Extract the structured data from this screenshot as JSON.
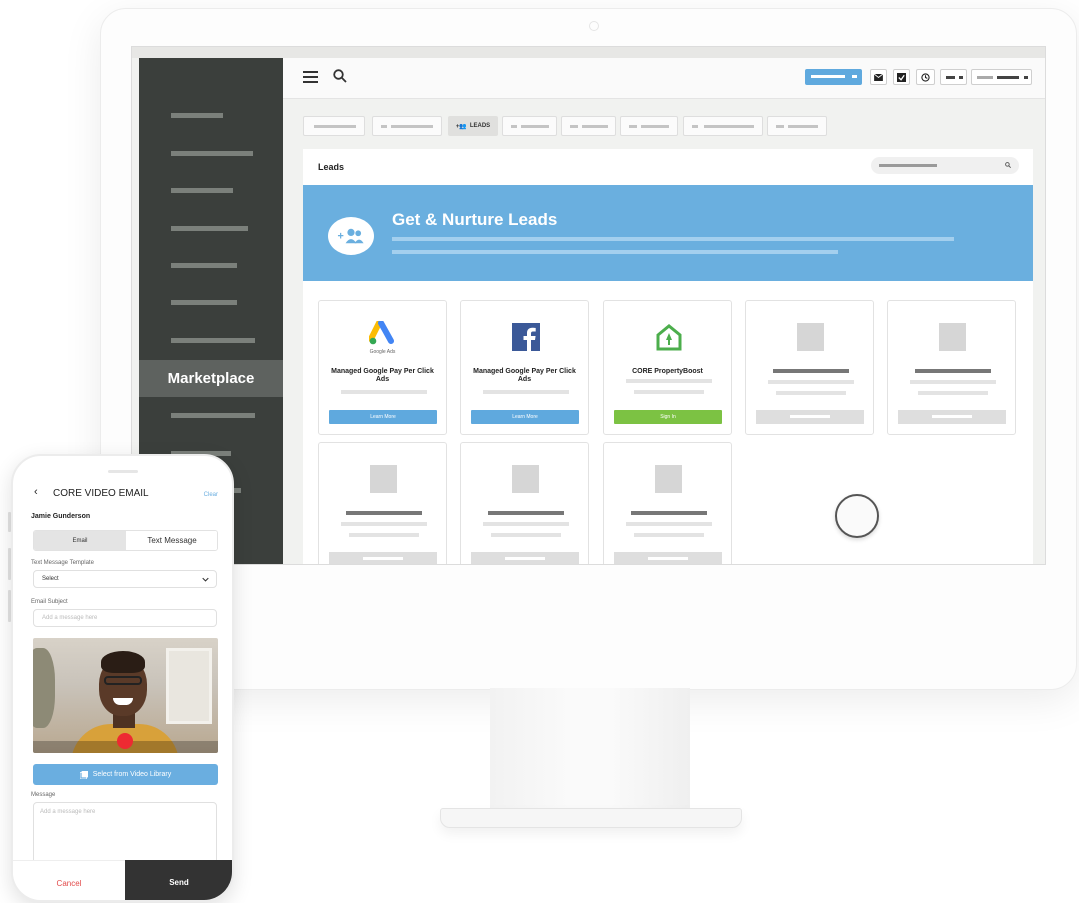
{
  "desktop": {
    "sidebar": {
      "active_label": "Marketplace"
    },
    "tabs": {
      "active_label": "LEADS"
    },
    "panel": {
      "title": "Leads",
      "banner_title": "Get & Nurture Leads"
    },
    "cards": [
      {
        "logo": "google-ads-logo",
        "logo_caption": "Google Ads",
        "title": "Managed Google Pay Per Click Ads",
        "button": "Learn More",
        "button_color": "#5fa9de"
      },
      {
        "logo": "facebook-logo",
        "title": "Managed Google Pay Per Click Ads",
        "button": "Learn More",
        "button_color": "#5fa9de"
      },
      {
        "logo": "core-propertyboost-logo",
        "title": "CORE PropertyBoost",
        "button": "Sign In",
        "button_color": "#7cc243"
      }
    ]
  },
  "phone": {
    "title": "CORE VIDEO EMAIL",
    "clear": "Clear",
    "contact": "Jamie Gunderson",
    "tabs": {
      "email": "Email",
      "text": "Text Message"
    },
    "template_label": "Text Message Template",
    "template_value": "Select",
    "subject_label": "Email Subject",
    "subject_placeholder": "Add a message here",
    "library_button": "Select from Video Library",
    "message_label": "Message",
    "message_placeholder": "Add a message here",
    "cancel": "Cancel",
    "send": "Send"
  },
  "colors": {
    "accent": "#6aaee0",
    "sidebar": "#3b3f3c",
    "success": "#7cc243",
    "danger": "#e24a4a"
  }
}
